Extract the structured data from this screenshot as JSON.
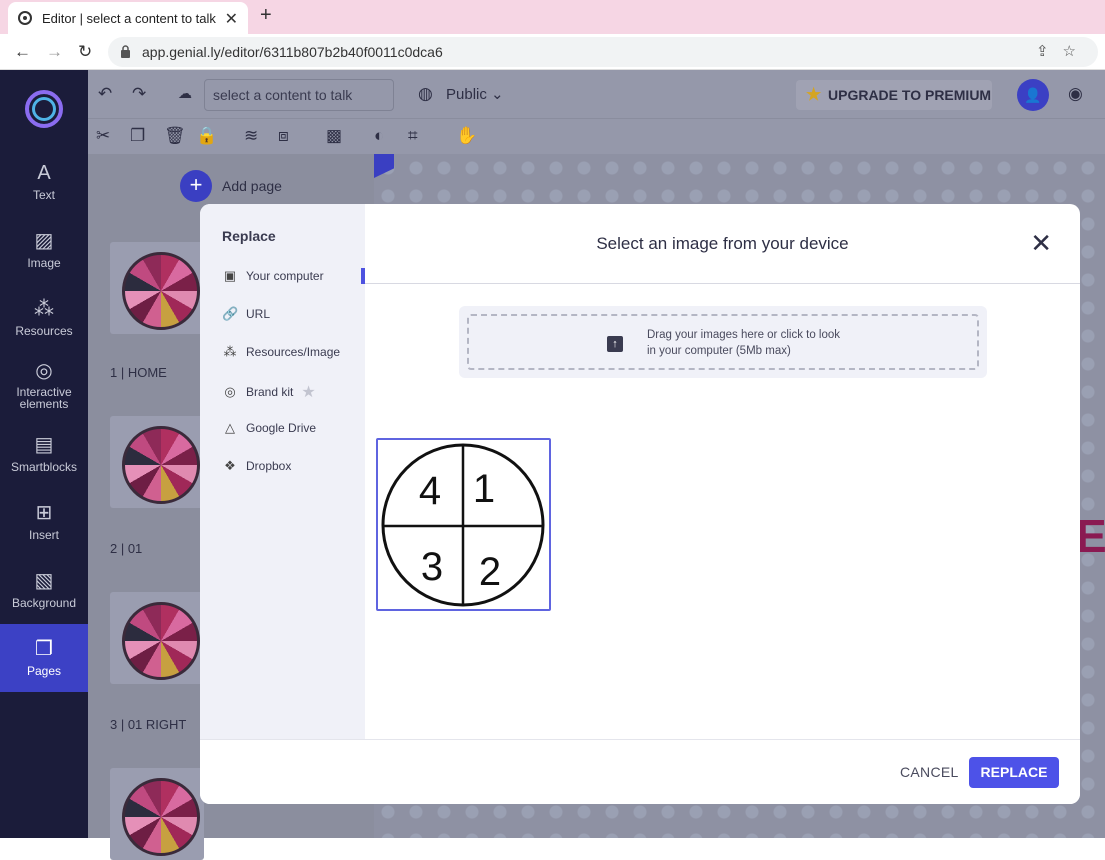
{
  "browser": {
    "tab_title": "Editor | select a content to talk",
    "url": "app.genial.ly/editor/6311b807b2b40f0011c0dca6"
  },
  "sidebar": {
    "items": [
      {
        "label": "Text",
        "icon": "text-icon"
      },
      {
        "label": "Image",
        "icon": "image-icon"
      },
      {
        "label": "Resources",
        "icon": "resources-icon"
      },
      {
        "label": "Interactive elements",
        "icon": "interactive-icon"
      },
      {
        "label": "Smartblocks",
        "icon": "smartblocks-icon"
      },
      {
        "label": "Insert",
        "icon": "insert-icon"
      },
      {
        "label": "Background",
        "icon": "background-icon"
      },
      {
        "label": "Pages",
        "icon": "pages-icon"
      }
    ]
  },
  "toolbar": {
    "search_placeholder": "select a content to talk",
    "visibility": "Public",
    "upgrade": "UPGRADE TO PREMIUM"
  },
  "pages": {
    "add_page": "Add page",
    "items": [
      "1 |  HOME",
      "2 |  01",
      "3 |  01 RIGHT"
    ]
  },
  "canvas": {
    "partial_letter": "E"
  },
  "modal": {
    "side_title": "Replace",
    "items": [
      "Your computer",
      "URL",
      "Resources/Image",
      "Brand kit",
      "Google Drive",
      "Dropbox"
    ],
    "title": "Select an image from your device",
    "drop_line1": "Drag your images here or click to look",
    "drop_line2": "in your computer (5Mb max)",
    "image_numbers": [
      "4",
      "1",
      "3",
      "2"
    ],
    "cancel": "CANCEL",
    "replace": "REPLACE"
  }
}
